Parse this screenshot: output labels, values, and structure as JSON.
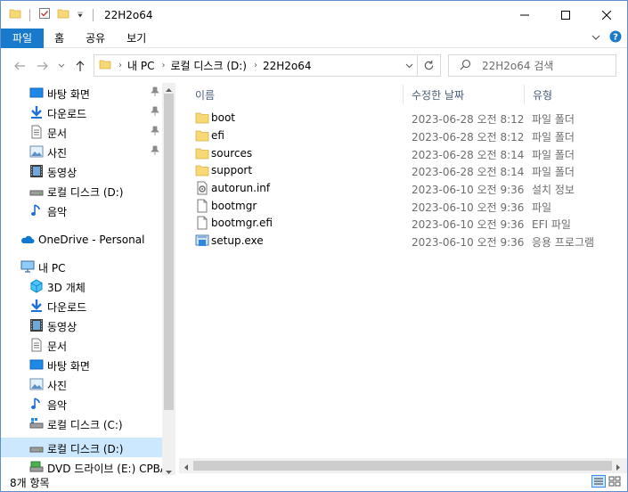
{
  "window": {
    "title": "22H2o64"
  },
  "ribbon": {
    "tabs": [
      "파일",
      "홈",
      "공유",
      "보기"
    ]
  },
  "address": {
    "segments": [
      "내 PC",
      "로컬 디스크 (D:)",
      "22H2o64"
    ],
    "search_placeholder": "22H2o64 검색"
  },
  "nav": {
    "quick_access": [
      {
        "label": "바탕 화면",
        "icon": "desktop-icon",
        "pinned": true
      },
      {
        "label": "다운로드",
        "icon": "download-icon",
        "pinned": true
      },
      {
        "label": "문서",
        "icon": "documents-icon",
        "pinned": true
      },
      {
        "label": "사진",
        "icon": "pictures-icon",
        "pinned": true
      },
      {
        "label": "동영상",
        "icon": "videos-icon",
        "pinned": false
      },
      {
        "label": "로컬 디스크 (D:)",
        "icon": "drive-icon",
        "pinned": false
      },
      {
        "label": "음악",
        "icon": "music-icon",
        "pinned": false
      }
    ],
    "onedrive": "OneDrive - Personal",
    "this_pc": "내 PC",
    "pc_items": [
      {
        "label": "3D 개체",
        "icon": "3d-objects-icon"
      },
      {
        "label": "다운로드",
        "icon": "download-icon"
      },
      {
        "label": "동영상",
        "icon": "videos-icon"
      },
      {
        "label": "문서",
        "icon": "documents-icon"
      },
      {
        "label": "바탕 화면",
        "icon": "desktop-icon"
      },
      {
        "label": "사진",
        "icon": "pictures-icon"
      },
      {
        "label": "음악",
        "icon": "music-icon"
      },
      {
        "label": "로컬 디스크 (C:)",
        "icon": "system-drive-icon"
      },
      {
        "label": "로컬 디스크 (D:)",
        "icon": "drive-icon",
        "selected": true
      },
      {
        "label": "DVD 드라이브 (E:) CPBA",
        "icon": "dvd-drive-icon"
      }
    ]
  },
  "columns": {
    "name": "이름",
    "date": "수정한 날짜",
    "type": "유형"
  },
  "files": [
    {
      "name": "boot",
      "date": "2023-06-28 오전 8:12",
      "type": "파일 폴더",
      "icon": "folder-icon"
    },
    {
      "name": "efi",
      "date": "2023-06-28 오전 8:12",
      "type": "파일 폴더",
      "icon": "folder-icon"
    },
    {
      "name": "sources",
      "date": "2023-06-28 오전 8:14",
      "type": "파일 폴더",
      "icon": "folder-icon"
    },
    {
      "name": "support",
      "date": "2023-06-28 오전 8:14",
      "type": "파일 폴더",
      "icon": "folder-icon"
    },
    {
      "name": "autorun.inf",
      "date": "2023-06-10 오전 9:36",
      "type": "설치 정보",
      "icon": "setup-info-file-icon"
    },
    {
      "name": "bootmgr",
      "date": "2023-06-10 오전 9:36",
      "type": "파일",
      "icon": "file-icon"
    },
    {
      "name": "bootmgr.efi",
      "date": "2023-06-10 오전 9:36",
      "type": "EFI 파일",
      "icon": "file-icon"
    },
    {
      "name": "setup.exe",
      "date": "2023-06-10 오전 9:36",
      "type": "응용 프로그램",
      "icon": "setup-exe-icon"
    }
  ],
  "status": {
    "item_count": "8개 항목"
  },
  "colors": {
    "accent": "#1979ca",
    "folder": "#f8d775",
    "selected_bg": "#cce8ff"
  }
}
